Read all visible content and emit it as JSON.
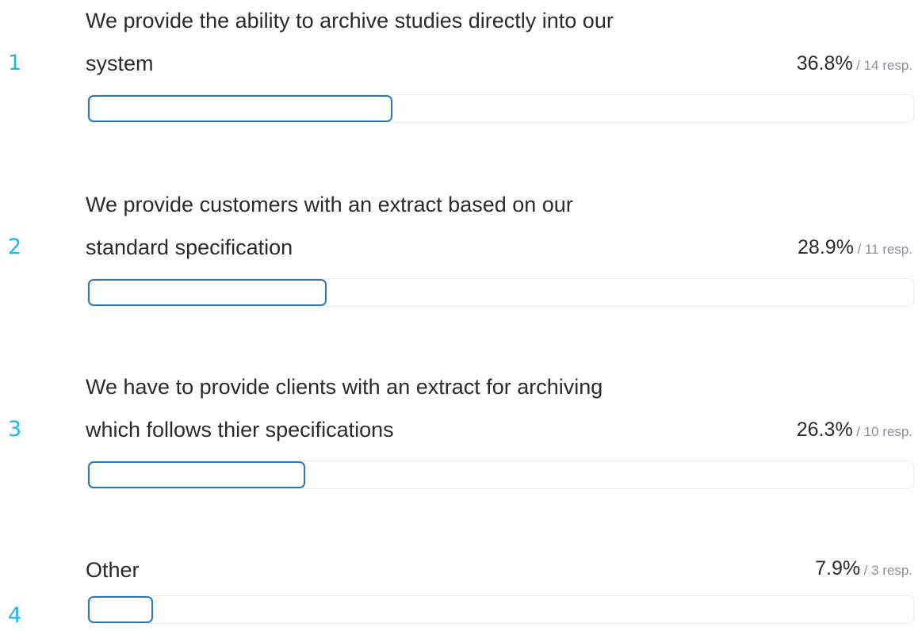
{
  "chart_data": {
    "type": "bar",
    "orientation": "horizontal",
    "colors": {
      "rank": "#1fb8e6",
      "bar_outline": "#2a7ab5",
      "track_border": "#e6eef3"
    },
    "resp_suffix": " resp.",
    "items": [
      {
        "rank": "1",
        "label_lines": [
          "We provide the ability to archive studies directly into our",
          "system"
        ],
        "percent": 36.8,
        "percent_text": "36.8%",
        "responses": 14,
        "resp_text": "/ 14 resp."
      },
      {
        "rank": "2",
        "label_lines": [
          "We provide customers with an extract based on our",
          "standard specification"
        ],
        "percent": 28.9,
        "percent_text": "28.9%",
        "responses": 11,
        "resp_text": "/ 11 resp."
      },
      {
        "rank": "3",
        "label_lines": [
          "We have to provide clients with an extract for archiving",
          "which follows thier specifications"
        ],
        "percent": 26.3,
        "percent_text": "26.3%",
        "responses": 10,
        "resp_text": "/ 10 resp."
      },
      {
        "rank": "4",
        "label_lines": [
          "Other"
        ],
        "percent": 7.9,
        "percent_text": "7.9%",
        "responses": 3,
        "resp_text": "/ 3 resp."
      }
    ]
  }
}
